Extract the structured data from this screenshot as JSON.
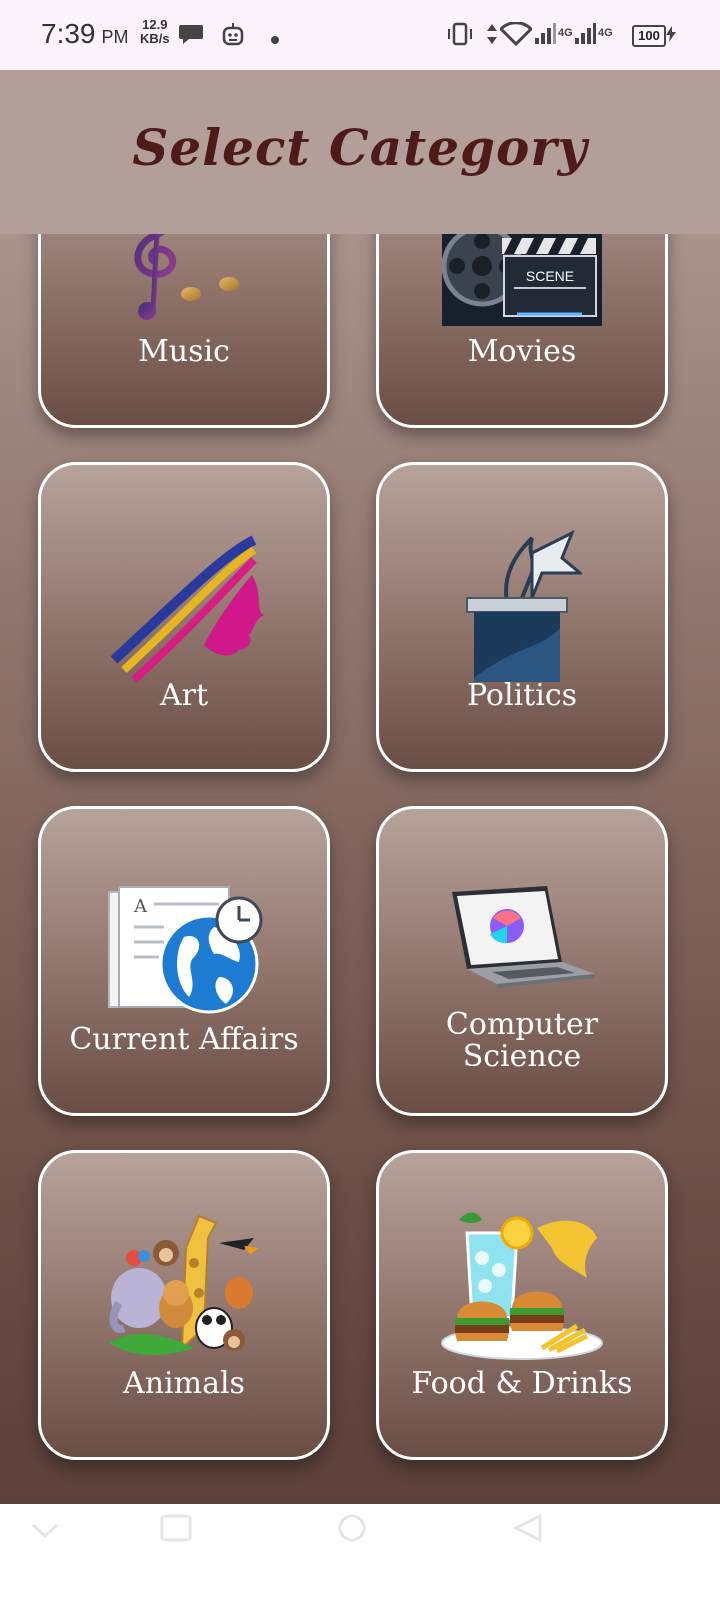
{
  "status_bar": {
    "time": "7:39",
    "ampm": "PM",
    "speed_value": "12.9",
    "speed_unit": "KB/s",
    "network_1": "4G",
    "network_2": "4G",
    "battery": "100"
  },
  "header": {
    "title": "Select Category"
  },
  "categories": [
    {
      "label": "Music",
      "icon": "music-notes-icon"
    },
    {
      "label": "Movies",
      "icon": "film-clapper-icon",
      "icon_text": "SCENE"
    },
    {
      "label": "Art",
      "icon": "art-face-icon"
    },
    {
      "label": "Politics",
      "icon": "ballot-box-icon"
    },
    {
      "label": "Current Affairs",
      "icon": "newspaper-globe-icon"
    },
    {
      "label_line1": "Computer",
      "label_line2": "Science",
      "icon": "laptop-icon"
    },
    {
      "label": "Animals",
      "icon": "animals-icon"
    },
    {
      "label": "Food & Drinks",
      "icon": "food-drinks-icon"
    }
  ],
  "colors": {
    "title": "#4e1a1a",
    "card_border": "#ffffff",
    "background_top": "#b39f9a",
    "background_bottom": "#5c4039"
  }
}
